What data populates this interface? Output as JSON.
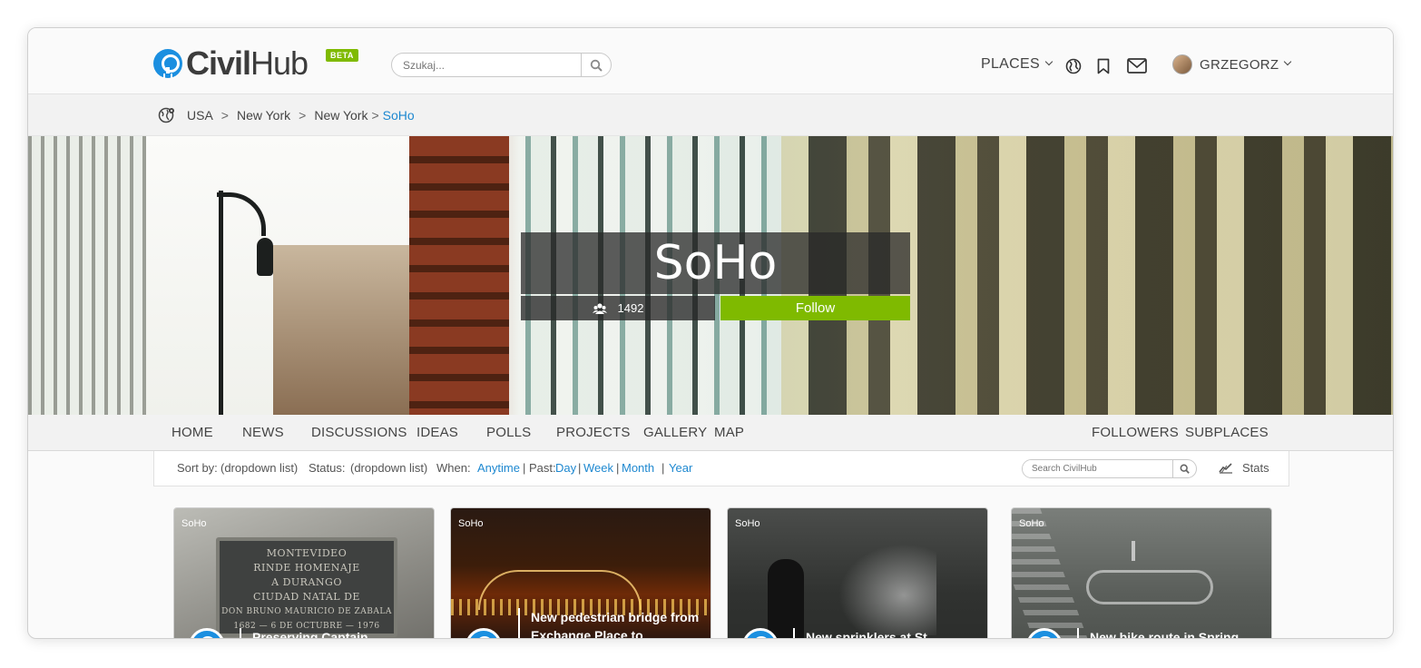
{
  "app": {
    "logo_bold": "Civil",
    "logo_regular": "Hub",
    "badge": "BETA",
    "brand_color": "#1b8fe0",
    "accent_color": "#7fba00",
    "link_color": "#1e88d0"
  },
  "header": {
    "search_placeholder": "Szukaj...",
    "places_label": "PLACES",
    "user_name": "GRZEGORZ",
    "icons": [
      "globe-icon",
      "bookmark-icon",
      "mail-icon"
    ]
  },
  "breadcrumb": {
    "items": [
      "USA",
      "New York",
      "New York"
    ],
    "separator": ">",
    "current": "SoHo"
  },
  "hero": {
    "title": "SoHo",
    "followers_count": "1492",
    "follow_label": "Follow"
  },
  "tabs": {
    "left": [
      "HOME",
      "NEWS",
      "DISCUSSIONS",
      "IDEAS",
      "POLLS",
      "PROJECTS",
      "GALLERY",
      "MAP"
    ],
    "right": [
      "FOLLOWERS",
      "SUBPLACES"
    ]
  },
  "filter": {
    "sort_label": "Sort by:",
    "sort_value": "(dropdown list)",
    "status_label": "Status:",
    "status_value": "(dropdown list)",
    "when_label": "When:",
    "anytime": "Anytime",
    "past_label": "| Past:",
    "day": "Day",
    "sep1": "|",
    "week": "Week",
    "sep2": "|",
    "month": "Month",
    "sep3": "|",
    "year": "Year",
    "search_placeholder": "Search CivilHub",
    "stats_label": "Stats"
  },
  "cards": [
    {
      "tag": "SoHo",
      "title": "Preserving Captain",
      "plaque": [
        "MONTEVIDEO",
        "RINDE HOMENAJE",
        "A DURANGO",
        "CIUDAD NATAL DE",
        "DON BRUNO MAURICIO DE ZABALA",
        "1682 — 6 DE OCTUBRE — 1976"
      ]
    },
    {
      "tag": "SoHo",
      "title": "New pedestrian bridge from Exchange Place to"
    },
    {
      "tag": "SoHo",
      "title": "New sprinklers at St"
    },
    {
      "tag": "SoHo",
      "title": "New bike route in Spring"
    }
  ]
}
